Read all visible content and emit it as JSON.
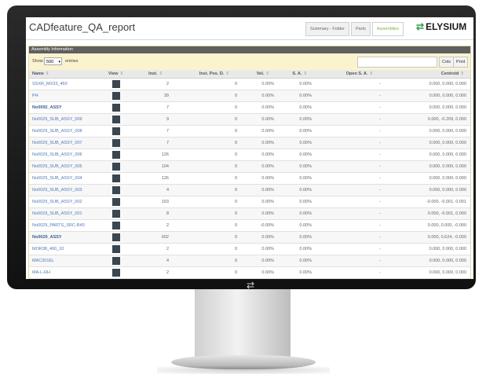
{
  "title": "CADfeature_QA_report",
  "tabs": [
    {
      "label": "Summary - Folder",
      "active": false
    },
    {
      "label": "Parts",
      "active": false
    },
    {
      "label": "Assemblies",
      "active": true
    }
  ],
  "logo": {
    "text": "ELYSIUM",
    "icon": "transfer-arrows-icon"
  },
  "panel": {
    "title": "Assembly Information",
    "show_label": "Show",
    "page_size": "500",
    "entries_label": "entries",
    "cols_label": "Cols",
    "print_label": "Print"
  },
  "columns": {
    "name": "Name",
    "view": "View",
    "inst": "Inst.",
    "inst_pos": "Inst. Pos. D.",
    "vol": "Vol.",
    "sa": "S. A.",
    "open_sa": "Open S. A.",
    "centroid": "Centroid"
  },
  "rows": [
    {
      "name": "SSXR_MX33_460",
      "bold": false,
      "inst": "2",
      "inst_pos": "0",
      "vol": "0.00%",
      "sa": "0.00%",
      "open_sa": "-",
      "centroid": "0.000, 0.000, 0.000"
    },
    {
      "name": "PH",
      "bold": false,
      "inst": "39",
      "inst_pos": "0",
      "vol": "0.00%",
      "sa": "0.00%",
      "open_sa": "-",
      "centroid": "0.000, 0.000, 0.000"
    },
    {
      "name": "No0092_ASSY",
      "bold": true,
      "inst": "7",
      "inst_pos": "0",
      "vol": "0.00%",
      "sa": "0.00%",
      "open_sa": "-",
      "centroid": "0.000, 0.000, 0.000"
    },
    {
      "name": "No0029_SUB_ASSY_009",
      "bold": false,
      "inst": "9",
      "inst_pos": "0",
      "vol": "0.00%",
      "sa": "0.00%",
      "open_sa": "-",
      "centroid": "0.000, -0.209, 0.000"
    },
    {
      "name": "No0029_SUB_ASSY_008",
      "bold": false,
      "inst": "7",
      "inst_pos": "0",
      "vol": "0.00%",
      "sa": "0.00%",
      "open_sa": "-",
      "centroid": "0.000, 0.000, 0.000"
    },
    {
      "name": "No0029_SUB_ASSY_007",
      "bold": false,
      "inst": "7",
      "inst_pos": "0",
      "vol": "0.00%",
      "sa": "0.00%",
      "open_sa": "-",
      "centroid": "0.000, 0.000, 0.000"
    },
    {
      "name": "No0029_SUB_ASSY_006",
      "bold": false,
      "inst": "126",
      "inst_pos": "0",
      "vol": "0.00%",
      "sa": "0.00%",
      "open_sa": "-",
      "centroid": "0.000, 0.000, 0.000"
    },
    {
      "name": "No0029_SUB_ASSY_005",
      "bold": false,
      "inst": "104",
      "inst_pos": "0",
      "vol": "0.00%",
      "sa": "0.00%",
      "open_sa": "-",
      "centroid": "0.000, 0.000, 0.000"
    },
    {
      "name": "No0029_SUB_ASSY_004",
      "bold": false,
      "inst": "126",
      "inst_pos": "0",
      "vol": "0.00%",
      "sa": "0.00%",
      "open_sa": "-",
      "centroid": "0.000, 0.000, 0.000"
    },
    {
      "name": "No0029_SUB_ASSY_003",
      "bold": false,
      "inst": "4",
      "inst_pos": "0",
      "vol": "0.00%",
      "sa": "0.00%",
      "open_sa": "-",
      "centroid": "0.000, 0.000, 0.000"
    },
    {
      "name": "No0029_SUB_ASSY_002",
      "bold": false,
      "inst": "163",
      "inst_pos": "0",
      "vol": "0.00%",
      "sa": "0.00%",
      "open_sa": "-",
      "centroid": "-0.000, -0.001, 0.001"
    },
    {
      "name": "No0029_SUB_ASSY_001",
      "bold": false,
      "inst": "8",
      "inst_pos": "0",
      "vol": "0.00%",
      "sa": "0.00%",
      "open_sa": "-",
      "centroid": "0.000, -0.001, 0.000"
    },
    {
      "name": "No0029_PARTS_SRC-R40",
      "bold": false,
      "inst": "2",
      "inst_pos": "0",
      "vol": "-0.00%",
      "sa": "0.00%",
      "open_sa": "-",
      "centroid": "0.000, 0.000, -0.000"
    },
    {
      "name": "No0029_ASSY",
      "bold": true,
      "inst": "602",
      "inst_pos": "0",
      "vol": "0.00%",
      "sa": "0.00%",
      "open_sa": "-",
      "centroid": "0.000, 0.624, -0.000"
    },
    {
      "name": "MOR38_400_10",
      "bold": false,
      "inst": "2",
      "inst_pos": "0",
      "vol": "0.00%",
      "sa": "0.00%",
      "open_sa": "-",
      "centroid": "0.000, 0.000, 0.000"
    },
    {
      "name": "MAC201EL",
      "bold": false,
      "inst": "4",
      "inst_pos": "0",
      "vol": "0.00%",
      "sa": "0.00%",
      "open_sa": "-",
      "centroid": "0.000, 0.000, 0.000"
    },
    {
      "name": "MA-L-RH",
      "bold": false,
      "inst": "2",
      "inst_pos": "0",
      "vol": "0.00%",
      "sa": "0.00%",
      "open_sa": "-",
      "centroid": "0.000, 0.000, 0.000"
    }
  ],
  "monitor_icon": "transfer-arrows-icon"
}
